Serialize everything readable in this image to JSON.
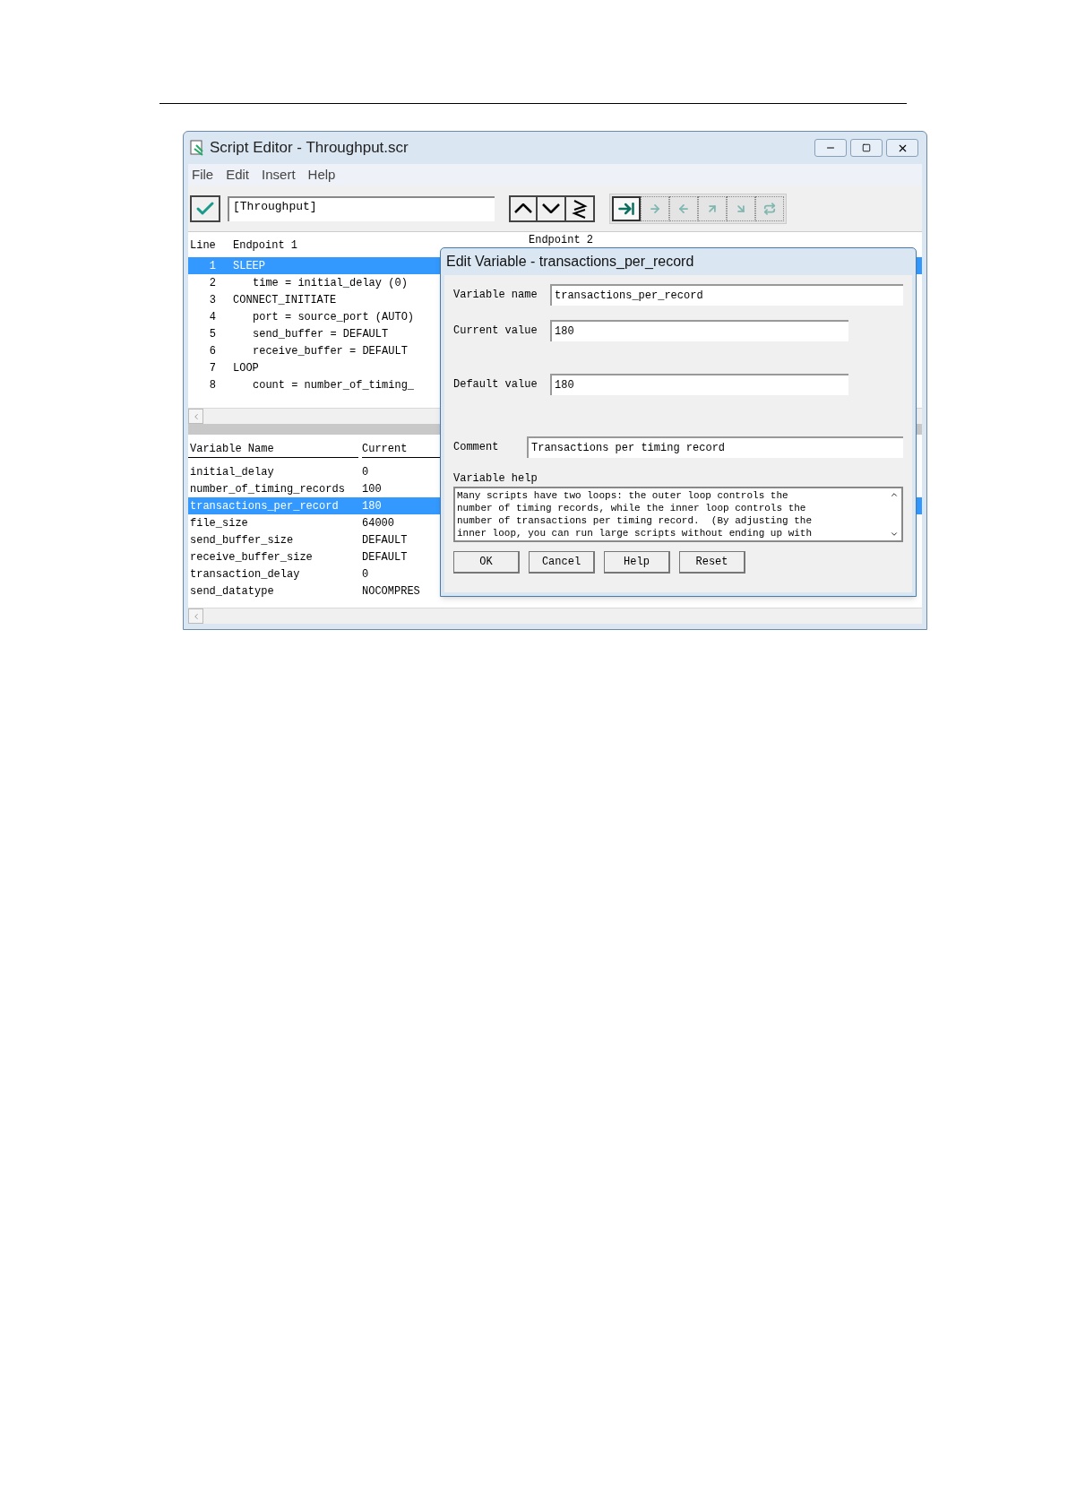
{
  "window": {
    "title": "Script Editor - Throughput.scr"
  },
  "menu": [
    "File",
    "Edit",
    "Insert",
    "Help"
  ],
  "toolbar": {
    "script_name": "[Throughput]",
    "action_buttons": [
      {
        "kind": "insert",
        "disabled": false
      },
      {
        "kind": "right",
        "disabled": true
      },
      {
        "kind": "left",
        "disabled": true
      },
      {
        "kind": "up",
        "disabled": true
      },
      {
        "kind": "down",
        "disabled": true
      },
      {
        "kind": "loop",
        "disabled": true
      }
    ]
  },
  "script": {
    "columns": [
      "Line",
      "Endpoint 1",
      "Endpoint 2"
    ],
    "rows": [
      {
        "line": "1",
        "text": "SLEEP",
        "selected": true,
        "children": [
          {
            "line": "2",
            "text": "time = initial_delay (0)",
            "selected": false
          }
        ]
      },
      {
        "line": "3",
        "text": "CONNECT_INITIATE",
        "selected": false,
        "children": [
          {
            "line": "4",
            "text": "port = source_port (AUTO)",
            "selected": false
          },
          {
            "line": "5",
            "text": "send_buffer = DEFAULT",
            "selected": false
          },
          {
            "line": "6",
            "text": "receive_buffer = DEFAULT",
            "selected": false
          }
        ]
      },
      {
        "line": "7",
        "text": "LOOP",
        "selected": false,
        "children": [
          {
            "line": "8",
            "text": "count = number_of_timing_",
            "selected": false
          }
        ]
      }
    ]
  },
  "variables": {
    "columns": [
      "Variable Name",
      "Current"
    ],
    "rows": [
      {
        "name": "initial_delay",
        "value": "0",
        "selected": false
      },
      {
        "name": "number_of_timing_records",
        "value": "100",
        "selected": false
      },
      {
        "name": "transactions_per_record",
        "value": "180",
        "selected": true
      },
      {
        "name": "file_size",
        "value": "64000",
        "selected": false
      },
      {
        "name": "send_buffer_size",
        "value": "DEFAULT",
        "selected": false
      },
      {
        "name": "receive_buffer_size",
        "value": "DEFAULT",
        "selected": false
      },
      {
        "name": "transaction_delay",
        "value": "0",
        "selected": false
      },
      {
        "name": "send_datatype",
        "value": "NOCOMPRES",
        "selected": false
      }
    ]
  },
  "dialog": {
    "title": "Edit Variable - transactions_per_record",
    "fields": [
      {
        "label": "Variable name",
        "value": "transactions_per_record"
      },
      {
        "label": "Current value",
        "value": "180"
      },
      {
        "label": "Default value",
        "value": "180"
      },
      {
        "label": "Comment",
        "value": "Transactions per timing record"
      }
    ],
    "help": {
      "label": "Variable help",
      "text": "Many scripts have two loops: the outer loop controls the\nnumber of timing records, while the inner loop controls the\nnumber of transactions per timing record.  (By adjusting the\ninner loop, you can run large scripts without ending up with"
    },
    "buttons": [
      "OK",
      "Cancel",
      "Help",
      "Reset"
    ]
  }
}
